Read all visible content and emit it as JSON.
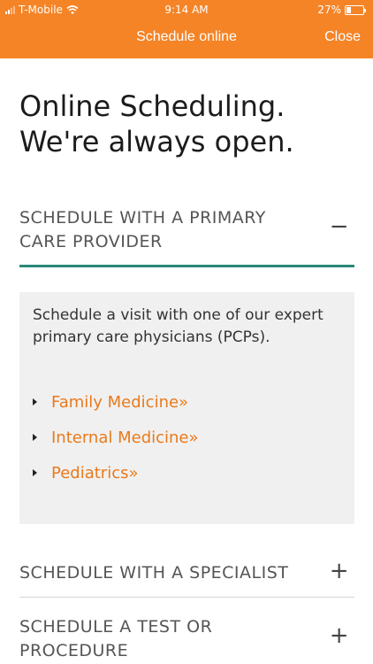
{
  "status_bar": {
    "carrier": "T-Mobile",
    "time": "9:14 AM",
    "battery_percent": "27%",
    "battery_level": 0.27,
    "icons": [
      "signal-icon",
      "wifi-icon",
      "battery-icon"
    ]
  },
  "nav": {
    "title": "Schedule online",
    "close_label": "Close"
  },
  "heading": {
    "line1": "Online Scheduling.",
    "line2": "We're always open."
  },
  "sections": [
    {
      "label": "SCHEDULE WITH A PRIMARY CARE PROVIDER",
      "toggle": "−",
      "expanded": true,
      "description": "Schedule a visit with one of our expert primary care physicians (PCPs).",
      "links": [
        {
          "label": "Family Medicine»"
        },
        {
          "label": "Internal Medicine»"
        },
        {
          "label": "Pediatrics»"
        }
      ]
    },
    {
      "label": "SCHEDULE WITH A SPECIALIST",
      "toggle": "+",
      "expanded": false
    },
    {
      "label": "SCHEDULE A TEST OR PROCEDURE",
      "toggle": "+",
      "expanded": false
    }
  ],
  "colors": {
    "brand_orange": "#f58427",
    "link_orange": "#e87a1c",
    "accent_teal": "#2a8a78",
    "panel_bg": "#f0f0f0"
  }
}
